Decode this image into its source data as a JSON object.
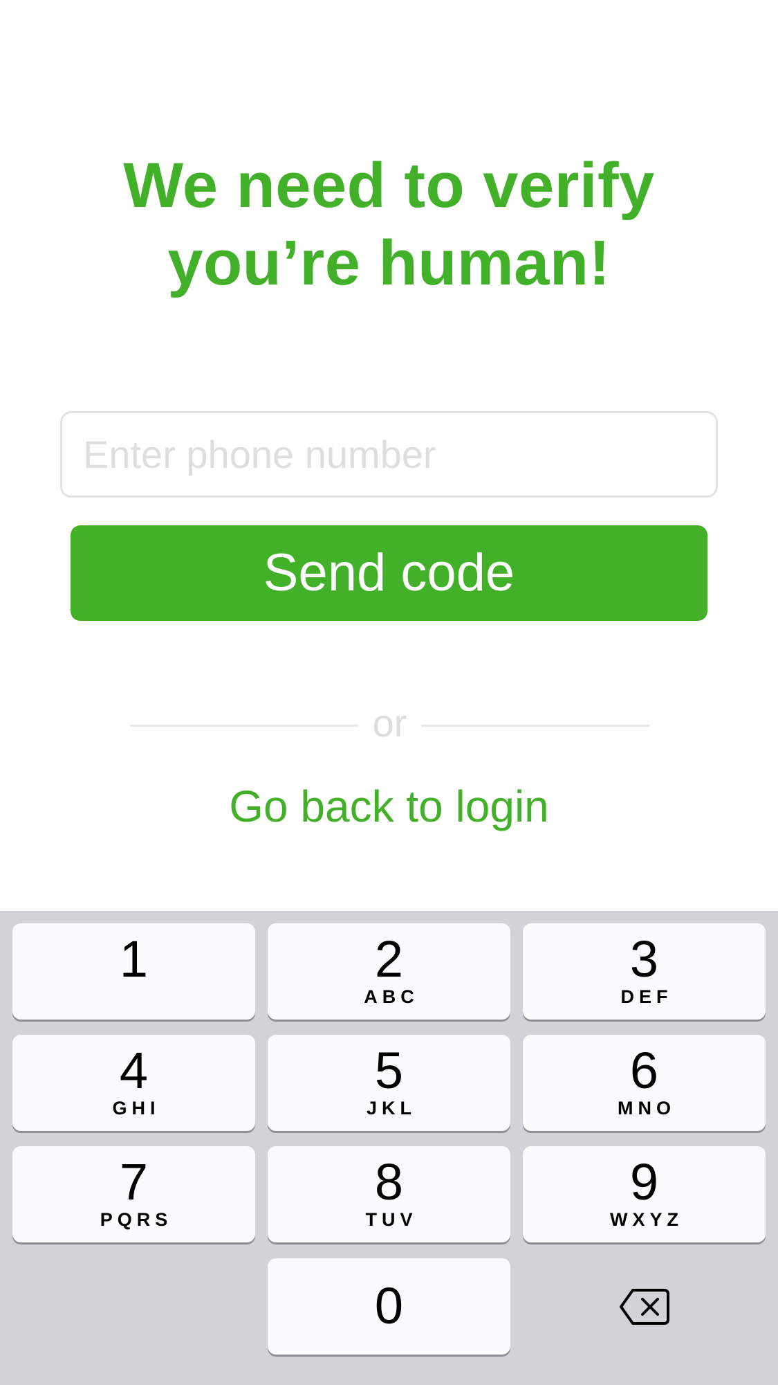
{
  "title": {
    "line1": "We need to verify",
    "line2": "you’re human!"
  },
  "phone_input": {
    "placeholder": "Enter phone number",
    "value": ""
  },
  "send_button": {
    "label": "Send code"
  },
  "divider": {
    "label": "or"
  },
  "back_link": {
    "label": "Go back to login"
  },
  "keypad": {
    "keys": [
      {
        "digit": "1",
        "letters": ""
      },
      {
        "digit": "2",
        "letters": "ABC"
      },
      {
        "digit": "3",
        "letters": "DEF"
      },
      {
        "digit": "4",
        "letters": "GHI"
      },
      {
        "digit": "5",
        "letters": "JKL"
      },
      {
        "digit": "6",
        "letters": "MNO"
      },
      {
        "digit": "7",
        "letters": "PQRS"
      },
      {
        "digit": "8",
        "letters": "TUV"
      },
      {
        "digit": "9",
        "letters": "WXYZ"
      },
      {
        "digit": "0",
        "letters": ""
      }
    ],
    "delete_icon": "backspace-icon"
  },
  "colors": {
    "accent": "#43b02a",
    "keypad_background": "#d1d3d9",
    "key_background": "#fbfbfd",
    "input_border": "#e3e3e3",
    "placeholder": "#dedede"
  }
}
